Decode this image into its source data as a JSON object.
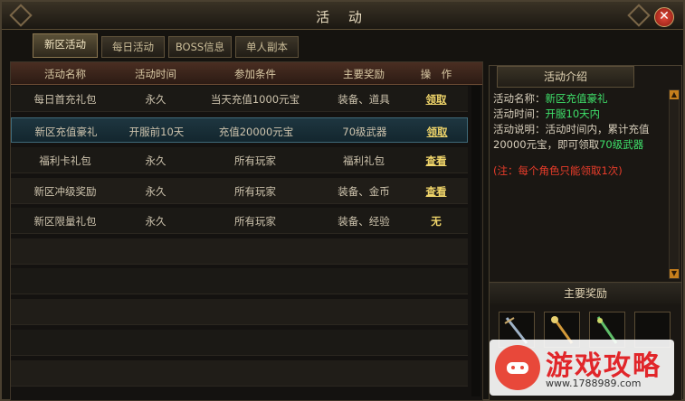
{
  "window": {
    "title": "活 动",
    "close_label": "✕"
  },
  "tabs": [
    {
      "label": "新区活动",
      "active": true
    },
    {
      "label": "每日活动",
      "active": false
    },
    {
      "label": "BOSS信息",
      "active": false
    },
    {
      "label": "单人副本",
      "active": false
    }
  ],
  "table": {
    "headers": [
      "活动名称",
      "活动时间",
      "参加条件",
      "主要奖励",
      "操　作"
    ],
    "rows": [
      {
        "name": "每日首充礼包",
        "time": "永久",
        "condition": "当天充值1000元宝",
        "reward": "装备、道具",
        "action": "领取",
        "action_type": "link"
      },
      {
        "name": "新区充值豪礼",
        "time": "开服前10天",
        "condition": "充值20000元宝",
        "reward": "70级武器",
        "action": "领取",
        "action_type": "link"
      },
      {
        "name": "福利卡礼包",
        "time": "永久",
        "condition": "所有玩家",
        "reward": "福利礼包",
        "action": "查看",
        "action_type": "link"
      },
      {
        "name": "新区冲级奖励",
        "time": "永久",
        "condition": "所有玩家",
        "reward": "装备、金币",
        "action": "查看",
        "action_type": "link"
      },
      {
        "name": "新区限量礼包",
        "time": "永久",
        "condition": "所有玩家",
        "reward": "装备、经验",
        "action": "无",
        "action_type": "plain"
      }
    ]
  },
  "intro": {
    "header": "活动介绍",
    "name_label": "活动名称：",
    "name_value": "新区充值豪礼",
    "time_label": "活动时间：",
    "time_value": "开服10天内",
    "desc_label": "活动说明：",
    "desc_text": "活动时间内，累计充值20000元宝，即可领取",
    "desc_highlight": "70级武器",
    "note": "(注：每个角色只能领取1次)"
  },
  "rewards": {
    "header": "主要奖励"
  },
  "watermark": {
    "text": "游戏攻略",
    "url": "www.1788989.com"
  },
  "colors": {
    "highlight": "#3fe06a",
    "warning": "#e83c2a",
    "action": "#f0d56a"
  }
}
